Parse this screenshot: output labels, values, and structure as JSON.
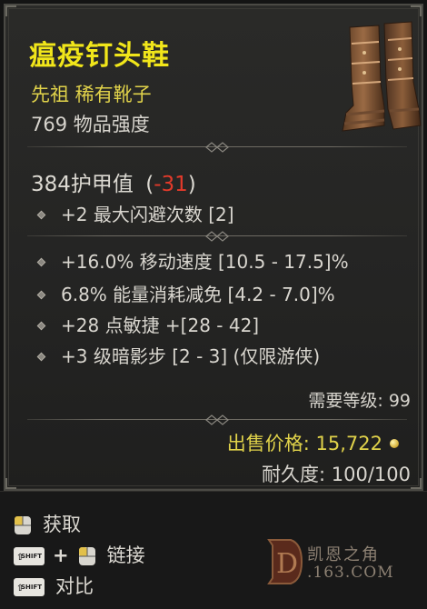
{
  "item": {
    "name": "瘟疫钉头鞋",
    "type": "先祖 稀有靴子",
    "power": "769 物品强度"
  },
  "armor": {
    "value": "384护甲值",
    "diff_open": "(",
    "diff": "-31",
    "diff_close": ")"
  },
  "implicit_stats": [
    "+2 最大闪避次数 [2]"
  ],
  "affix_stats": [
    "+16.0% 移动速度 [10.5 - 17.5]%",
    "6.8% 能量消耗减免 [4.2 - 7.0]%",
    "+28 点敏捷 +[28 - 42]",
    "+3 级暗影步 [2 - 3] (仅限游侠)"
  ],
  "requirement": "需要等级: 99",
  "sell_price": "出售价格: 15,722",
  "durability": "耐久度: 100/100",
  "actions": {
    "acquire": "获取",
    "link": "链接",
    "compare": "对比",
    "plus": "+",
    "shift_label": "SHIFT"
  },
  "watermark": {
    "brand": "凯恩之角",
    "domain": ".163.COM",
    "letter": "D"
  },
  "colors": {
    "legendary_name": "#f1e61a",
    "rarity": "#e0d24a",
    "negative": "#e23a2a"
  },
  "icons": [
    "mouse-left-icon",
    "shift-key-icon",
    "mouse-right-icon",
    "gold-coin-icon",
    "boots-image"
  ]
}
